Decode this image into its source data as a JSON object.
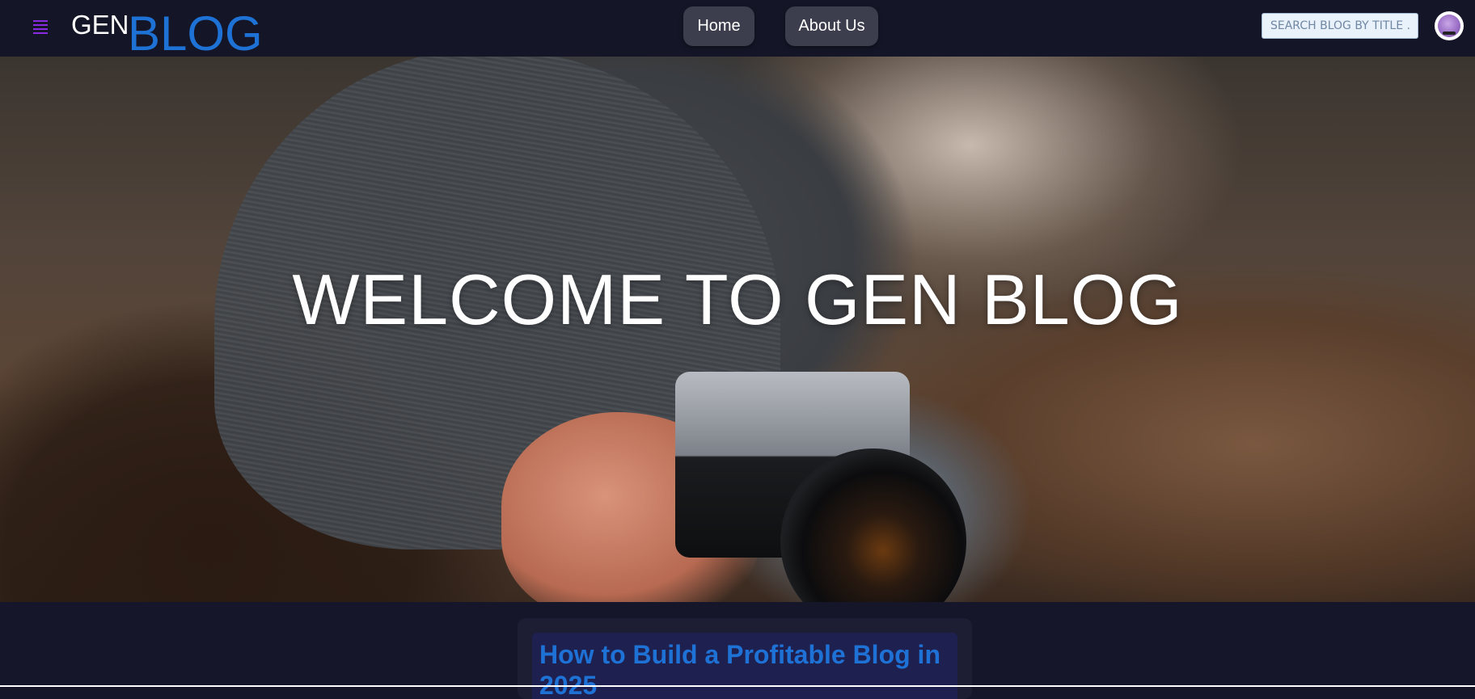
{
  "header": {
    "logo": {
      "part1": "GEN",
      "part2": "BLOG"
    },
    "nav": [
      {
        "label": "Home"
      },
      {
        "label": "About Us"
      }
    ],
    "search": {
      "placeholder": "SEARCH BLOG BY TITLE ..."
    },
    "menu_icon": "hamburger-icon",
    "avatar_icon": "user-avatar"
  },
  "hero": {
    "title": "WELCOME TO GEN BLOG"
  },
  "posts": [
    {
      "title": "How to Build a Profitable Blog in 2025"
    }
  ],
  "colors": {
    "background": "#15162a",
    "navbar": "#141526",
    "accent_blue": "#1e72d6",
    "menu_icon": "#8a2be2",
    "nav_button": "#3c3d4d",
    "card": "#1d1e33"
  }
}
